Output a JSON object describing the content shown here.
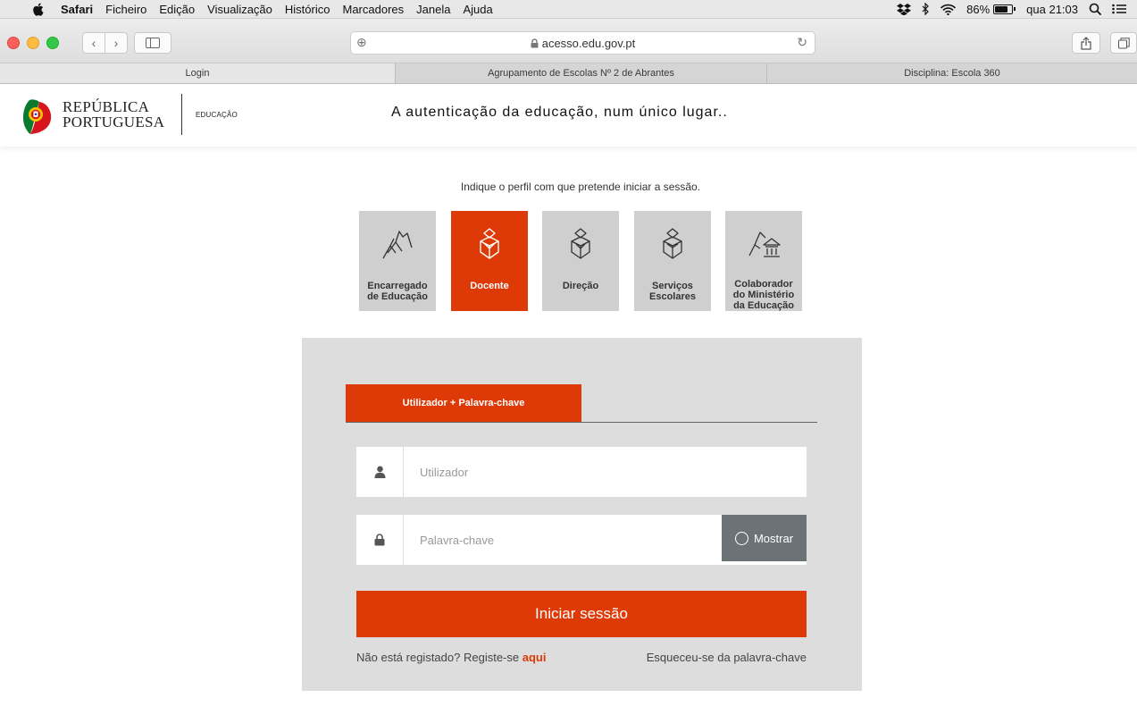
{
  "menubar": {
    "items": [
      {
        "label": "Safari",
        "bold": true
      },
      {
        "label": "Ficheiro"
      },
      {
        "label": "Edição"
      },
      {
        "label": "Visualização"
      },
      {
        "label": "Histórico"
      },
      {
        "label": "Marcadores"
      },
      {
        "label": "Janela"
      },
      {
        "label": "Ajuda"
      }
    ],
    "battery": "86%",
    "battery_level": 0.86,
    "clock": "qua 21:03"
  },
  "browser": {
    "url": "acesso.edu.gov.pt",
    "tabs": [
      {
        "label": "Login",
        "active": true
      },
      {
        "label": "Agrupamento de Escolas Nº 2 de Abrantes",
        "active": false
      },
      {
        "label": "Disciplina: Escola 360",
        "active": false
      }
    ]
  },
  "header": {
    "brand_line1": "REPÚBLICA",
    "brand_line2": "PORTUGUESA",
    "section": "EDUCAÇÃO",
    "tagline": "A autenticação da educação, num único lugar.."
  },
  "profiles": {
    "instruction": "Indique o perfil com que pretende iniciar a sessão.",
    "items": [
      {
        "label": "Encarregado\nde Educação",
        "icon": "guardian-icon",
        "active": false
      },
      {
        "label": "Docente",
        "icon": "teacher-icon",
        "active": true
      },
      {
        "label": "Direção",
        "icon": "direction-icon",
        "active": false
      },
      {
        "label": "Serviços\nEscolares",
        "icon": "school-services-icon",
        "active": false
      },
      {
        "label": "Colaborador\ndo Ministério\nda Educação",
        "icon": "ministry-icon",
        "active": false
      }
    ]
  },
  "login": {
    "tab_label": "Utilizador + Palavra-chave",
    "username_placeholder": "Utilizador",
    "password_placeholder": "Palavra-chave",
    "show_label": "Mostrar",
    "submit_label": "Iniciar sessão",
    "register_text": "Não está registado? Registe-se ",
    "register_link": "aqui",
    "forgot_text": "Esqueceu-se da palavra-chave"
  },
  "colors": {
    "accent": "#de3a08",
    "panel": "#dddddd",
    "profile_inactive": "#cfcfcf",
    "show_button": "#6c7377"
  }
}
